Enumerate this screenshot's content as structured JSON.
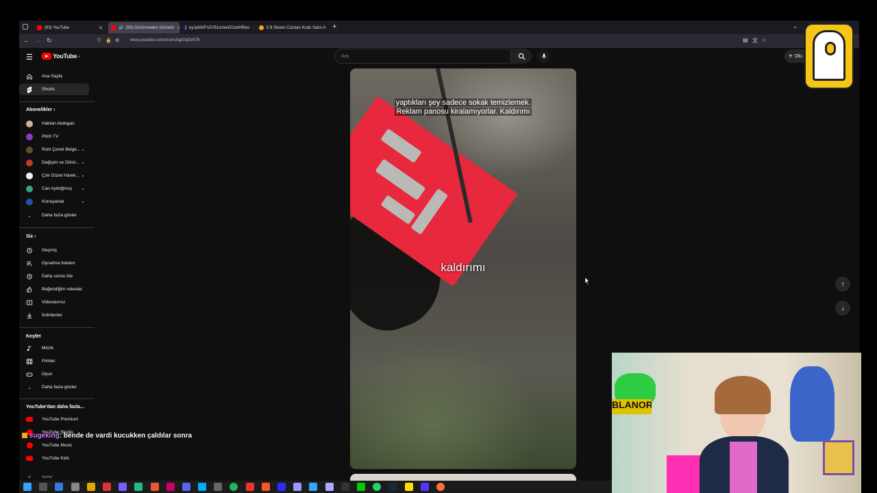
{
  "tabs": [
    {
      "label": "(93) YouTube",
      "color": "#ff0000"
    },
    {
      "label": "(93) Görünmeden Görünür",
      "color": "#ff0000"
    },
    {
      "label": "eyJpbWFnZV91cmwiOiJodHRwc",
      "color": "#3d6aff"
    },
    {
      "label": "5 $ Steam Cüzdan Kodu Satın A",
      "color": "#f5a623"
    }
  ],
  "address": {
    "url": "www.youtube.com/shorts/lajG3jOv678"
  },
  "youtube": {
    "logo": "YouTube",
    "logo_region": "AT",
    "search_placeholder": "Ara",
    "create_label": "Olu",
    "nav": [
      {
        "label": "Ana Sayfa",
        "icon": "home-icon"
      },
      {
        "label": "Shorts",
        "icon": "shorts-icon"
      }
    ],
    "subscriptions_title": "Abonelikler",
    "subscriptions": [
      {
        "label": "Haktan Akdogan",
        "color": "#c9b3a0",
        "new": false
      },
      {
        "label": "Pitch TV",
        "color": "#8a3ac9",
        "new": false
      },
      {
        "label": "Ruhi Çenet Belge...",
        "color": "#6b4a2a",
        "new": true
      },
      {
        "label": "Değişim ve Dönü...",
        "color": "#c0392b",
        "new": true
      },
      {
        "label": "Çok Güzel Harek...",
        "color": "#f2f2f2",
        "new": true
      },
      {
        "label": "Can Aydoğmuş",
        "color": "#3aa57a",
        "new": true
      },
      {
        "label": "Konuşanlar",
        "color": "#2a4fa8",
        "new": true
      }
    ],
    "show_more_1": "Daha fazla göster",
    "you_title": "Siz",
    "you_items": [
      {
        "label": "Geçmiş",
        "icon": "history-icon"
      },
      {
        "label": "Oynatma listeleri",
        "icon": "playlist-icon"
      },
      {
        "label": "Daha sonra izle",
        "icon": "clock-icon"
      },
      {
        "label": "Beğendiğim videolar",
        "icon": "like-icon"
      },
      {
        "label": "Videolarınız",
        "icon": "video-icon"
      },
      {
        "label": "İndirilenler",
        "icon": "download-icon"
      }
    ],
    "explore_title": "Keşfet",
    "explore_items": [
      {
        "label": "Müzik",
        "icon": "music-icon"
      },
      {
        "label": "Filmler",
        "icon": "film-icon"
      },
      {
        "label": "Oyun",
        "icon": "game-icon"
      }
    ],
    "show_more_2": "Daha fazla göster",
    "more_title": "YouTube'dan daha fazla...",
    "more_items": [
      {
        "label": "YouTube Premium"
      },
      {
        "label": "YouTube Studio"
      },
      {
        "label": "YouTube Music"
      },
      {
        "label": "YouTube Kids"
      }
    ],
    "settings_partial": "Ayarlar"
  },
  "video": {
    "caption_top_line1": "yaptıkları şey sadece sokak temizlemek.",
    "caption_top_line2": "Reklam panosu kiralamıyorlar. Kaldırımı",
    "caption_center": "kaldırımı"
  },
  "chat": {
    "username": "sugeking",
    "message": ": bende de vardi kucukken çaldılar sonra"
  },
  "webcam": {
    "sign_text": "BLANORA"
  },
  "colors": {
    "youtube_red": "#ff0000",
    "sign_red": "#e8283c",
    "logo_yellow": "#f5c518"
  }
}
